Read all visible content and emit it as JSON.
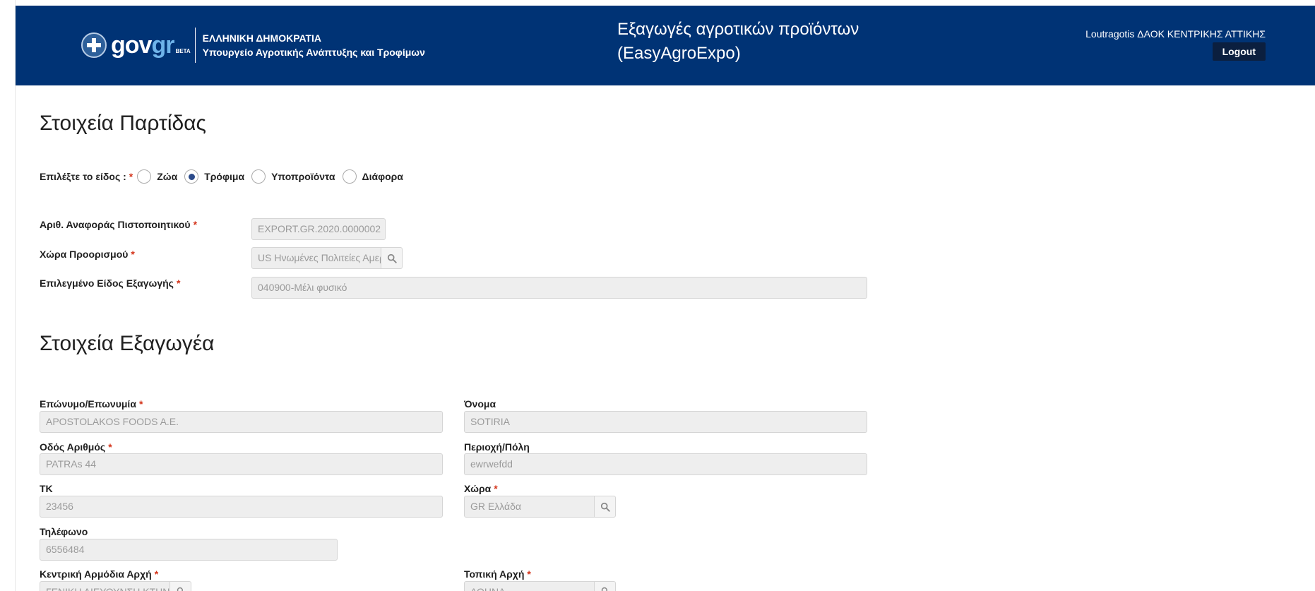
{
  "header": {
    "gov_logo": {
      "part1": "gov",
      "part2": "gr",
      "badge": "BETA"
    },
    "ministry_line1": "ΕΛΛΗΝΙΚΗ ΔΗΜΟΚΡΑΤΙΑ",
    "ministry_line2": "Υπουργείο Αγροτικής Ανάπτυξης και Τροφίμων",
    "app_title_line1": "Εξαγωγές αγροτικών προϊόντων",
    "app_title_line2": "(EasyAgroExpo)",
    "user": "Loutragotis ΔΑΟΚ ΚΕΝΤΡΙΚΗΣ ΑΤΤΙΚΗΣ",
    "logout_label": "Logout"
  },
  "batch_section": {
    "title": "Στοιχεία Παρτίδας",
    "type_label": "Επιλέξτε το είδος :",
    "required_mark": "*",
    "type_options": [
      {
        "label": "Ζώα",
        "checked": false
      },
      {
        "label": "Τρόφιμα",
        "checked": true
      },
      {
        "label": "Υποπροϊόντα",
        "checked": false
      },
      {
        "label": "Διάφορα",
        "checked": false
      }
    ],
    "cert_ref_label": "Αριθ. Αναφοράς Πιστοποιητικού",
    "cert_ref_value": "EXPORT.GR.2020.0000002",
    "destination_label": "Χώρα Προορισμού",
    "destination_value": "US Ηνωμένες Πολιτείες Αμερικής",
    "export_type_label": "Επιλεγμένο Είδος Εξαγωγής",
    "export_type_value": "040900-Μέλι φυσικό"
  },
  "exporter_section": {
    "title": "Στοιχεία Εξαγωγέα",
    "surname_label": "Επώνυμο/Επωνυμία",
    "surname_value": "APOSTOLAKOS FOODS A.E.",
    "name_label": "Όνομα",
    "name_value": "SOTIRIA",
    "street_label": "Οδός Αριθμός",
    "street_value": "PATRAs 44",
    "area_label": "Περιοχή/Πόλη",
    "area_value": "ewrwefdd",
    "zip_label": "ΤΚ",
    "zip_value": "23456",
    "country_label": "Χώρα",
    "country_value": "GR Ελλάδα",
    "phone_label": "Τηλέφωνο",
    "phone_value": "6556484",
    "central_authority_label": "Κεντρική Αρμόδια Αρχή",
    "central_authority_value": "ΓΕΝΙΚΗ ΔΙΕΥΘΥΝΣΗ ΚΤΗΝΙΑΤΡΙΚΗΣ",
    "local_authority_label": "Τοπική Αρχή",
    "local_authority_value": "ΑΘΗΝΑ"
  },
  "icons": {
    "search": "search-icon",
    "emblem": "greek-emblem-icon"
  },
  "colors": {
    "header_bg": "#003375",
    "required": "#d4351c",
    "logout_bg": "#0b1f3f",
    "field_bg": "#eeeeee"
  }
}
